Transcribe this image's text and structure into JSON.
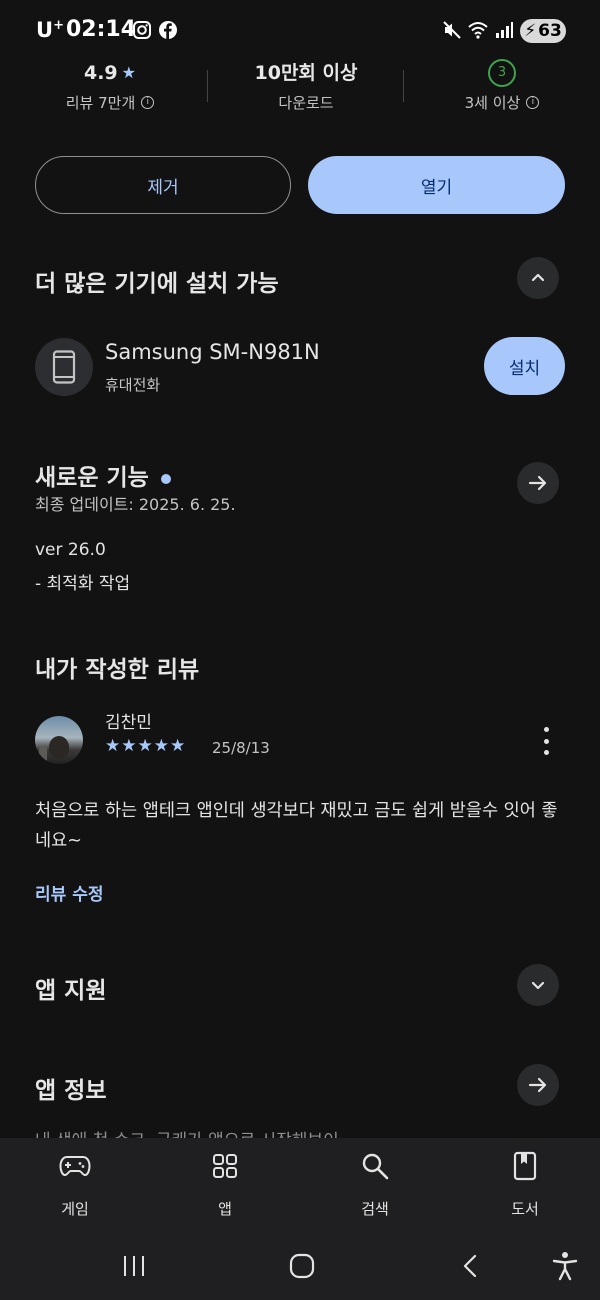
{
  "status_bar": {
    "carrier": "U",
    "carrier_sup": "+",
    "time": "02:14",
    "battery": "63"
  },
  "stats": {
    "rating": "4.9",
    "reviews": "리뷰 7만개",
    "downloads": "10만회 이상",
    "downloads_label": "다운로드",
    "age_rating": "3",
    "age_label": "3세 이상"
  },
  "actions": {
    "remove_label": "제거",
    "open_label": "열기"
  },
  "more_devices": {
    "title": "더 많은 기기에 설치 가능",
    "device_name": "Samsung SM-N981N",
    "device_type": "휴대전화",
    "install_label": "설치"
  },
  "whats_new": {
    "title": "새로운 기능",
    "updated": "최종 업데이트: 2025. 6. 25.",
    "version": "ver 26.0",
    "note": "- 최적화 작업"
  },
  "my_review": {
    "title": "내가 작성한 리뷰",
    "reviewer": "김찬민",
    "stars": "★★★★★",
    "date": "25/8/13",
    "text": "처음으로 하는 앱테크 앱인데 생각보다 재밌고 금도 쉽게 받을수 잇어 좋네요~",
    "edit_label": "리뷰 수정"
  },
  "app_support": {
    "title": "앱 지원"
  },
  "app_info": {
    "title": "앱 정보",
    "peek": "내 생애 첫 수크, 국캐가 앱으로 시작해보이"
  },
  "bottom_nav": {
    "items": [
      {
        "label": "게임",
        "icon": "gamepad-icon"
      },
      {
        "label": "앱",
        "icon": "apps-grid-icon"
      },
      {
        "label": "검색",
        "icon": "search-icon"
      },
      {
        "label": "도서",
        "icon": "book-icon"
      }
    ]
  },
  "colors": {
    "background": "#121212",
    "accent": "#a8c7fa",
    "age_green": "#3fa34d"
  }
}
